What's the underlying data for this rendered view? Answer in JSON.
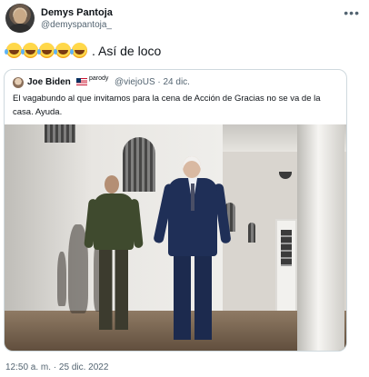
{
  "tweet": {
    "author_name": "Demys Pantoja",
    "author_handle": "@demyspantoja_",
    "more_icon": "more-horizontal-icon",
    "emoji_count": 5,
    "emoji_icon": "rolling-on-floor-laughing-emoji",
    "text": ". Así de loco",
    "timestamp": "12:50 a. m. · 25 dic. 2022"
  },
  "quoted_tweet": {
    "author_name": "Joe Biden",
    "flag_icon": "us-flag-icon",
    "badge": "parody",
    "handle_date": "@viejoUS · 24 dic.",
    "text": "El vagabundo al que invitamos para la cena de Acción de Gracias no se va de la casa. Ayuda.",
    "media_icon": "photo-two-men-walking-colonnade"
  }
}
